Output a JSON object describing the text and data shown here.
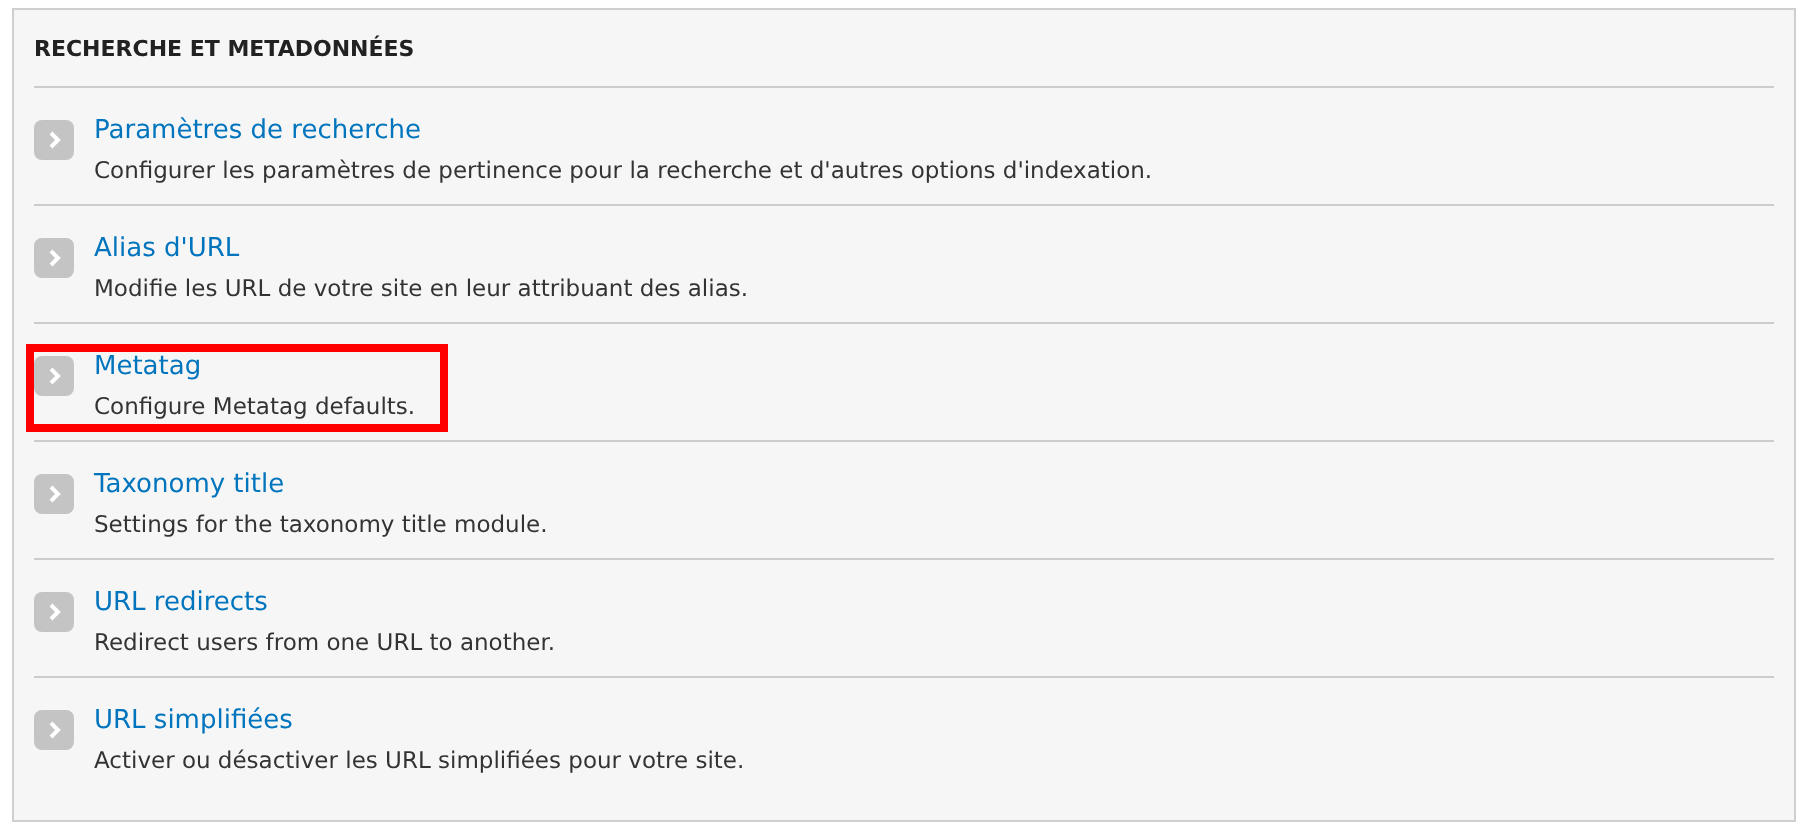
{
  "panel": {
    "title": "RECHERCHE ET METADONNÉES",
    "items": [
      {
        "title": "Paramètres de recherche",
        "description": "Configurer les paramètres de pertinence pour la recherche et d'autres options d'indexation.",
        "highlighted": false
      },
      {
        "title": "Alias d'URL",
        "description": "Modifie les URL de votre site en leur attribuant des alias.",
        "highlighted": false
      },
      {
        "title": "Metatag",
        "description": "Configure Metatag defaults.",
        "highlighted": true
      },
      {
        "title": "Taxonomy title",
        "description": "Settings for the taxonomy title module.",
        "highlighted": false
      },
      {
        "title": "URL redirects",
        "description": "Redirect users from one URL to another.",
        "highlighted": false
      },
      {
        "title": "URL simplifiées",
        "description": "Activer ou désactiver les URL simplifiées pour votre site.",
        "highlighted": false
      }
    ]
  }
}
